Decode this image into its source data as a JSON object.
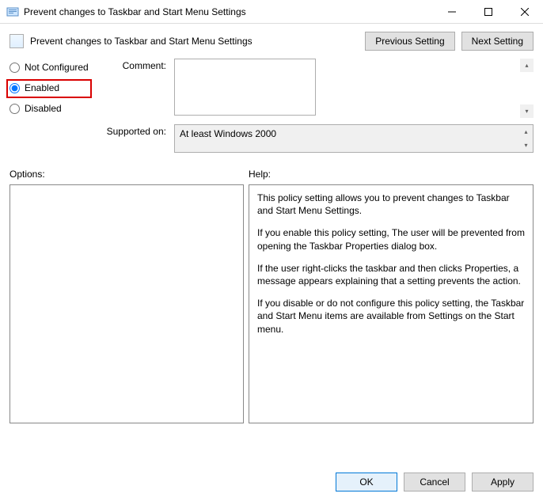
{
  "window": {
    "title": "Prevent changes to Taskbar and Start Menu Settings"
  },
  "header": {
    "title": "Prevent changes to Taskbar and Start Menu Settings",
    "prev_btn": "Previous Setting",
    "next_btn": "Next Setting"
  },
  "radios": {
    "not_configured": "Not Configured",
    "enabled": "Enabled",
    "disabled": "Disabled"
  },
  "fields": {
    "comment_label": "Comment:",
    "comment_value": "",
    "supported_label": "Supported on:",
    "supported_value": "At least Windows 2000"
  },
  "panels": {
    "options_label": "Options:",
    "help_label": "Help:"
  },
  "help": {
    "p1": "This policy setting allows you to prevent changes to Taskbar and Start Menu Settings.",
    "p2": "If you enable this policy setting, The user will be prevented from opening the Taskbar Properties dialog box.",
    "p3": "If the user right-clicks the taskbar and then clicks Properties, a message appears explaining that a setting prevents the action.",
    "p4": "If you disable or do not configure this policy setting, the Taskbar and Start Menu items are available from Settings on the Start menu."
  },
  "buttons": {
    "ok": "OK",
    "cancel": "Cancel",
    "apply": "Apply"
  }
}
